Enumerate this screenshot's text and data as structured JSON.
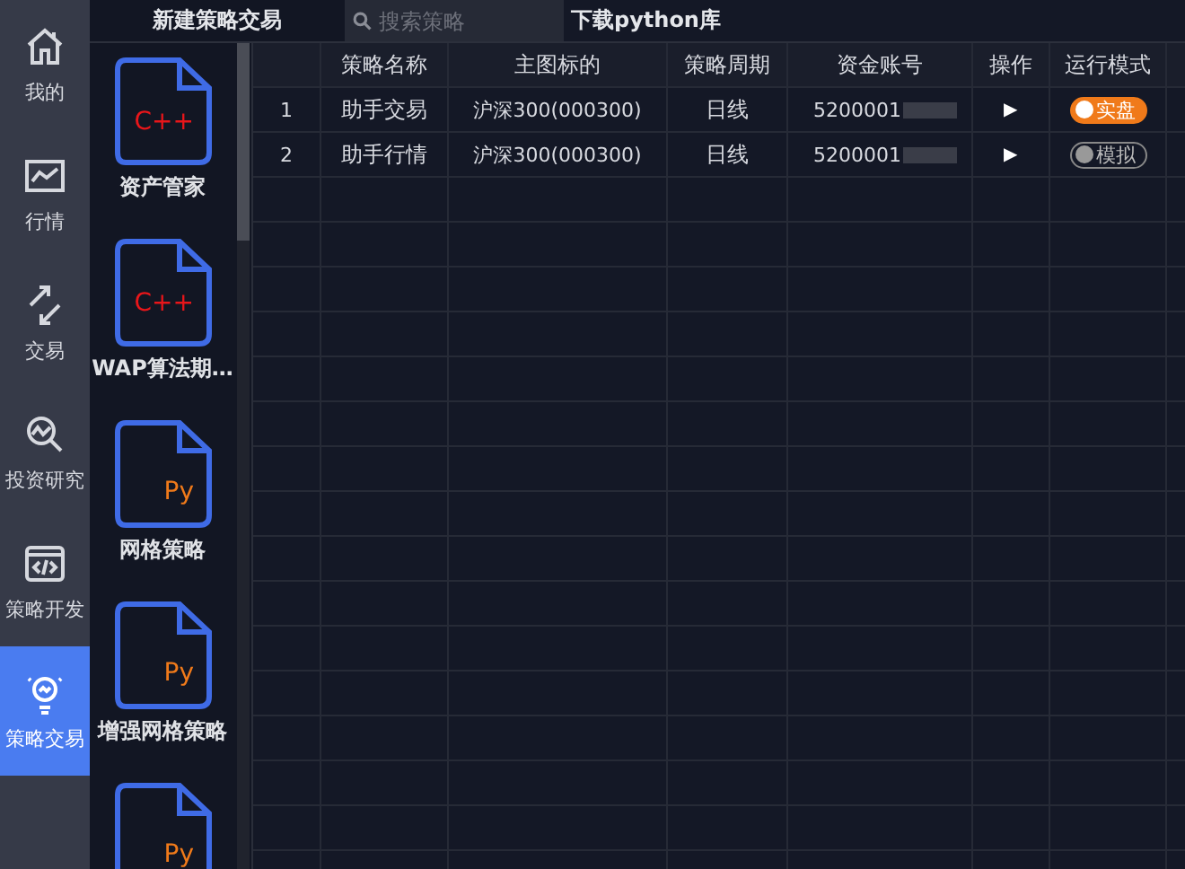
{
  "nav": [
    {
      "label": "我的",
      "kind": "home",
      "selected": false
    },
    {
      "label": "行情",
      "kind": "chart",
      "selected": false
    },
    {
      "label": "交易",
      "kind": "arrows",
      "selected": false
    },
    {
      "label": "投资研究",
      "kind": "research",
      "selected": false
    },
    {
      "label": "策略开发",
      "kind": "code",
      "selected": false
    },
    {
      "label": "策略交易",
      "kind": "bulb",
      "selected": true
    }
  ],
  "toolbar": {
    "new_button": "新建策略交易",
    "search": {
      "placeholder": "搜索策略"
    },
    "download_link": "下载python库"
  },
  "strategies": [
    {
      "lang": "C++",
      "name": "资产管家"
    },
    {
      "lang": "C++",
      "name": "WAP算法期…"
    },
    {
      "lang": "Py",
      "name": "网格策略"
    },
    {
      "lang": "Py",
      "name": "增强网格策略"
    },
    {
      "lang": "Py"
    }
  ],
  "table": {
    "columns": [
      "",
      "策略名称",
      "主图标的",
      "策略周期",
      "资金账号",
      "操作",
      "运行模式"
    ],
    "rows": [
      {
        "index": "1",
        "name": "助手交易",
        "symbol": "沪深300(000300)",
        "period": "日线",
        "account": "5200001",
        "action": "▶",
        "mode": {
          "label": "实盘",
          "on": true
        }
      },
      {
        "index": "2",
        "name": "助手行情",
        "symbol": "沪深300(000300)",
        "period": "日线",
        "account": "5200001",
        "action": "▶",
        "mode": {
          "label": "模拟",
          "on": false
        }
      }
    ]
  }
}
